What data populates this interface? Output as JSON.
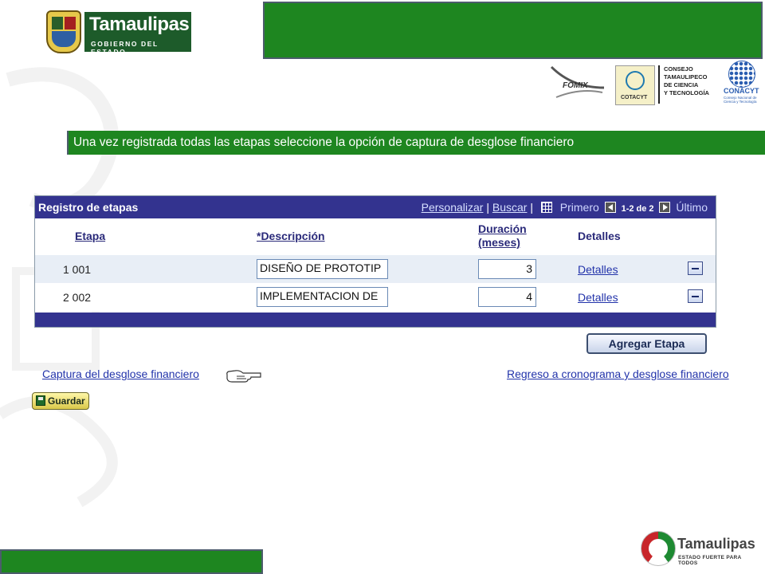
{
  "header": {
    "logo_word": "Tamaulipas",
    "logo_subtitle": "GOBIERNO DEL ESTADO"
  },
  "sponsors": {
    "fomix": "FOMIX",
    "cotacyt": "COTACYT",
    "consejo_lines": [
      "CONSEJO",
      "TAMAULIPECO",
      "DE CIENCIA",
      "Y TECNOLOGÍA"
    ],
    "conacyt": "CONACYT",
    "conacyt_sub": "Consejo Nacional de Ciencia y Tecnología"
  },
  "instruction": "Una vez registrada todas las etapas seleccione la opción de captura de desglose financiero",
  "grid": {
    "title": "Registro de etapas",
    "personalizar": "Personalizar",
    "buscar": "Buscar",
    "sep": "|",
    "primero": "Primero",
    "count": "1-2 de 2",
    "ultimo": "Último",
    "columns": {
      "etapa": "Etapa",
      "descripcion": "*Descripción",
      "duracion_1": "Duración",
      "duracion_2": "(meses)",
      "detalles": "Detalles"
    },
    "rows": [
      {
        "etapa": "1 001",
        "descripcion": "DISEÑO DE PROTOTIP",
        "duracion": "3",
        "detalles": "Detalles"
      },
      {
        "etapa": "2 002",
        "descripcion": "IMPLEMENTACION DE",
        "duracion": "4",
        "detalles": "Detalles"
      }
    ]
  },
  "actions": {
    "agregar": "Agregar Etapa",
    "captura_link": "Captura del desglose financiero",
    "regreso_link": "Regreso a cronograma y desglose financiero",
    "guardar": "Guardar"
  },
  "footer": {
    "logo_name": "Tamaulipas",
    "slogan": "ESTADO FUERTE PARA TODOS"
  },
  "colors": {
    "green": "#1e8620",
    "grid_header": "#33338f",
    "link": "#2233aa"
  }
}
